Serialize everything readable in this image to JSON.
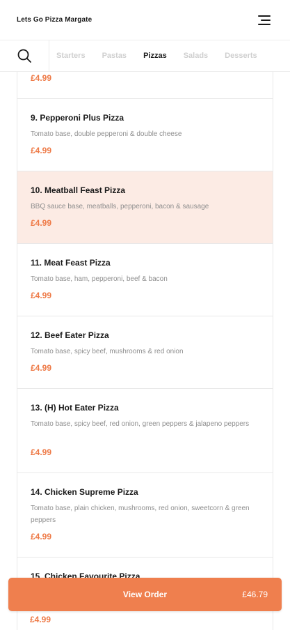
{
  "header": {
    "title": "Lets Go Pizza Margate",
    "menu_icon": "hamburger-menu-icon"
  },
  "tabs": {
    "search_icon": "search-icon",
    "items": [
      {
        "label": "Starters",
        "active": false
      },
      {
        "label": "Pastas",
        "active": false
      },
      {
        "label": "Pizzas",
        "active": true
      },
      {
        "label": "Salads",
        "active": false
      },
      {
        "label": "Desserts",
        "active": false
      }
    ]
  },
  "top_partial_price": "£4.99",
  "items": [
    {
      "name": "9. Pepperoni Plus Pizza",
      "description": "Tomato base, double pepperoni & double cheese",
      "price": "£4.99"
    },
    {
      "name": "10. Meatball Feast Pizza",
      "description": "BBQ sauce base, meatballs, pepperoni, bacon & sausage",
      "price": "£4.99",
      "highlight": true
    },
    {
      "name": "11. Meat Feast Pizza",
      "description": "Tomato base, ham, pepperoni, beef & bacon",
      "price": "£4.99"
    },
    {
      "name": "12. Beef Eater Pizza",
      "description": "Tomato base, spicy beef, mushrooms & red onion",
      "price": "£4.99"
    },
    {
      "name": "13. (H) Hot Eater Pizza",
      "description": "Tomato base, spicy beef, red onion, green peppers & jalapeno peppers",
      "price": "£4.99"
    },
    {
      "name": "14. Chicken Supreme Pizza",
      "description": "Tomato base, plain chicken, mushrooms, red onion, sweetcorn & green peppers",
      "price": "£4.99"
    },
    {
      "name": "15. Chicken Favourite Pizza",
      "description": "",
      "price": "£4.99"
    }
  ],
  "order": {
    "label": "View Order",
    "total": "£46.79"
  },
  "colors": {
    "accent": "#ef7f4e",
    "highlight_bg": "#fcebe4",
    "price": "#ee7a47"
  }
}
